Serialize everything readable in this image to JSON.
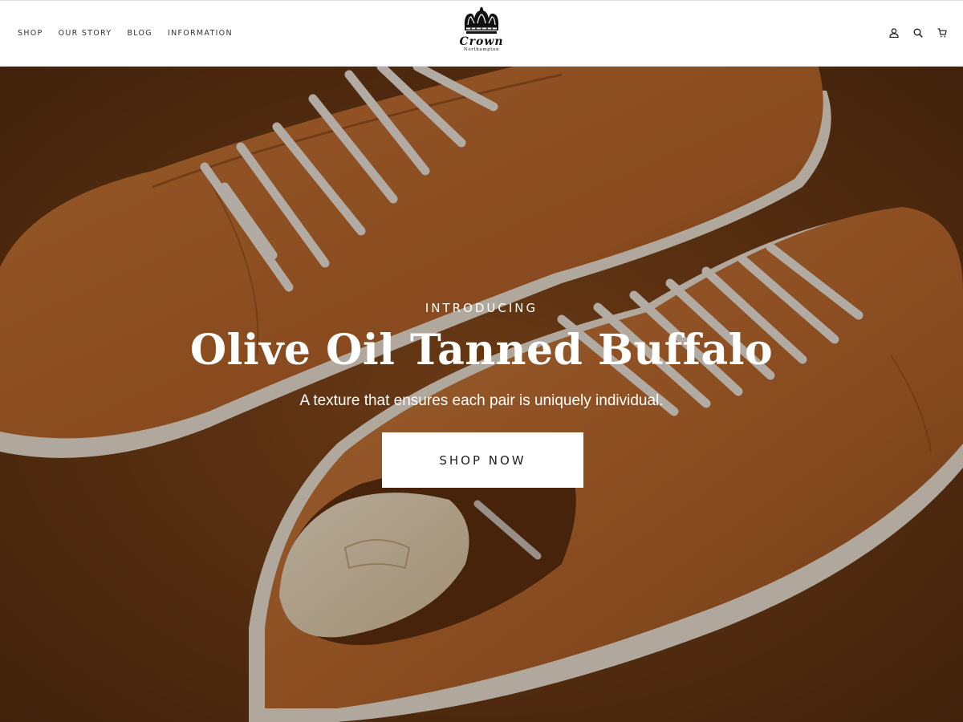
{
  "nav": {
    "items": [
      {
        "label": "SHOP"
      },
      {
        "label": "OUR STORY"
      },
      {
        "label": "BLOG"
      },
      {
        "label": "INFORMATION"
      }
    ]
  },
  "logo": {
    "wordmark": "Crown",
    "subtitle": "Northampton"
  },
  "header_icons": [
    "account-icon",
    "search-icon",
    "cart-icon"
  ],
  "hero": {
    "eyebrow": "INTRODUCING",
    "headline": "Olive Oil Tanned Buffalo",
    "subheadline": "A texture that ensures each pair is uniquely individual.",
    "cta_label": "SHOP NOW",
    "image_subject": "two tan leather sneakers with white laces and wooden shoe tree",
    "colors": {
      "leather": "#b5652a",
      "background": "#6b3a14",
      "laces": "#efeae2",
      "sole": "#e9e4da"
    }
  }
}
